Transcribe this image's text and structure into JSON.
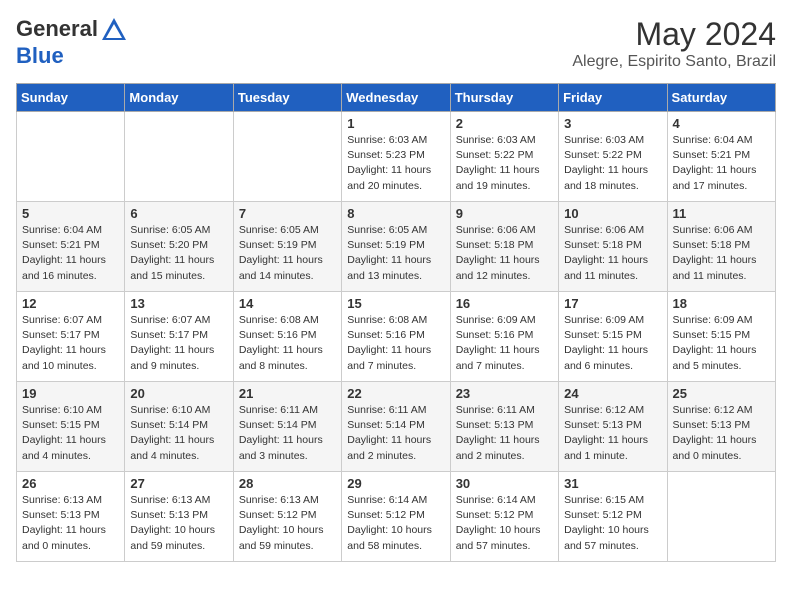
{
  "header": {
    "logo_general": "General",
    "logo_blue": "Blue",
    "month_year": "May 2024",
    "location": "Alegre, Espirito Santo, Brazil"
  },
  "days_of_week": [
    "Sunday",
    "Monday",
    "Tuesday",
    "Wednesday",
    "Thursday",
    "Friday",
    "Saturday"
  ],
  "weeks": [
    [
      {
        "day": "",
        "info": ""
      },
      {
        "day": "",
        "info": ""
      },
      {
        "day": "",
        "info": ""
      },
      {
        "day": "1",
        "info": "Sunrise: 6:03 AM\nSunset: 5:23 PM\nDaylight: 11 hours\nand 20 minutes."
      },
      {
        "day": "2",
        "info": "Sunrise: 6:03 AM\nSunset: 5:22 PM\nDaylight: 11 hours\nand 19 minutes."
      },
      {
        "day": "3",
        "info": "Sunrise: 6:03 AM\nSunset: 5:22 PM\nDaylight: 11 hours\nand 18 minutes."
      },
      {
        "day": "4",
        "info": "Sunrise: 6:04 AM\nSunset: 5:21 PM\nDaylight: 11 hours\nand 17 minutes."
      }
    ],
    [
      {
        "day": "5",
        "info": "Sunrise: 6:04 AM\nSunset: 5:21 PM\nDaylight: 11 hours\nand 16 minutes."
      },
      {
        "day": "6",
        "info": "Sunrise: 6:05 AM\nSunset: 5:20 PM\nDaylight: 11 hours\nand 15 minutes."
      },
      {
        "day": "7",
        "info": "Sunrise: 6:05 AM\nSunset: 5:19 PM\nDaylight: 11 hours\nand 14 minutes."
      },
      {
        "day": "8",
        "info": "Sunrise: 6:05 AM\nSunset: 5:19 PM\nDaylight: 11 hours\nand 13 minutes."
      },
      {
        "day": "9",
        "info": "Sunrise: 6:06 AM\nSunset: 5:18 PM\nDaylight: 11 hours\nand 12 minutes."
      },
      {
        "day": "10",
        "info": "Sunrise: 6:06 AM\nSunset: 5:18 PM\nDaylight: 11 hours\nand 11 minutes."
      },
      {
        "day": "11",
        "info": "Sunrise: 6:06 AM\nSunset: 5:18 PM\nDaylight: 11 hours\nand 11 minutes."
      }
    ],
    [
      {
        "day": "12",
        "info": "Sunrise: 6:07 AM\nSunset: 5:17 PM\nDaylight: 11 hours\nand 10 minutes."
      },
      {
        "day": "13",
        "info": "Sunrise: 6:07 AM\nSunset: 5:17 PM\nDaylight: 11 hours\nand 9 minutes."
      },
      {
        "day": "14",
        "info": "Sunrise: 6:08 AM\nSunset: 5:16 PM\nDaylight: 11 hours\nand 8 minutes."
      },
      {
        "day": "15",
        "info": "Sunrise: 6:08 AM\nSunset: 5:16 PM\nDaylight: 11 hours\nand 7 minutes."
      },
      {
        "day": "16",
        "info": "Sunrise: 6:09 AM\nSunset: 5:16 PM\nDaylight: 11 hours\nand 7 minutes."
      },
      {
        "day": "17",
        "info": "Sunrise: 6:09 AM\nSunset: 5:15 PM\nDaylight: 11 hours\nand 6 minutes."
      },
      {
        "day": "18",
        "info": "Sunrise: 6:09 AM\nSunset: 5:15 PM\nDaylight: 11 hours\nand 5 minutes."
      }
    ],
    [
      {
        "day": "19",
        "info": "Sunrise: 6:10 AM\nSunset: 5:15 PM\nDaylight: 11 hours\nand 4 minutes."
      },
      {
        "day": "20",
        "info": "Sunrise: 6:10 AM\nSunset: 5:14 PM\nDaylight: 11 hours\nand 4 minutes."
      },
      {
        "day": "21",
        "info": "Sunrise: 6:11 AM\nSunset: 5:14 PM\nDaylight: 11 hours\nand 3 minutes."
      },
      {
        "day": "22",
        "info": "Sunrise: 6:11 AM\nSunset: 5:14 PM\nDaylight: 11 hours\nand 2 minutes."
      },
      {
        "day": "23",
        "info": "Sunrise: 6:11 AM\nSunset: 5:13 PM\nDaylight: 11 hours\nand 2 minutes."
      },
      {
        "day": "24",
        "info": "Sunrise: 6:12 AM\nSunset: 5:13 PM\nDaylight: 11 hours\nand 1 minute."
      },
      {
        "day": "25",
        "info": "Sunrise: 6:12 AM\nSunset: 5:13 PM\nDaylight: 11 hours\nand 0 minutes."
      }
    ],
    [
      {
        "day": "26",
        "info": "Sunrise: 6:13 AM\nSunset: 5:13 PM\nDaylight: 11 hours\nand 0 minutes."
      },
      {
        "day": "27",
        "info": "Sunrise: 6:13 AM\nSunset: 5:13 PM\nDaylight: 10 hours\nand 59 minutes."
      },
      {
        "day": "28",
        "info": "Sunrise: 6:13 AM\nSunset: 5:12 PM\nDaylight: 10 hours\nand 59 minutes."
      },
      {
        "day": "29",
        "info": "Sunrise: 6:14 AM\nSunset: 5:12 PM\nDaylight: 10 hours\nand 58 minutes."
      },
      {
        "day": "30",
        "info": "Sunrise: 6:14 AM\nSunset: 5:12 PM\nDaylight: 10 hours\nand 57 minutes."
      },
      {
        "day": "31",
        "info": "Sunrise: 6:15 AM\nSunset: 5:12 PM\nDaylight: 10 hours\nand 57 minutes."
      },
      {
        "day": "",
        "info": ""
      }
    ]
  ]
}
